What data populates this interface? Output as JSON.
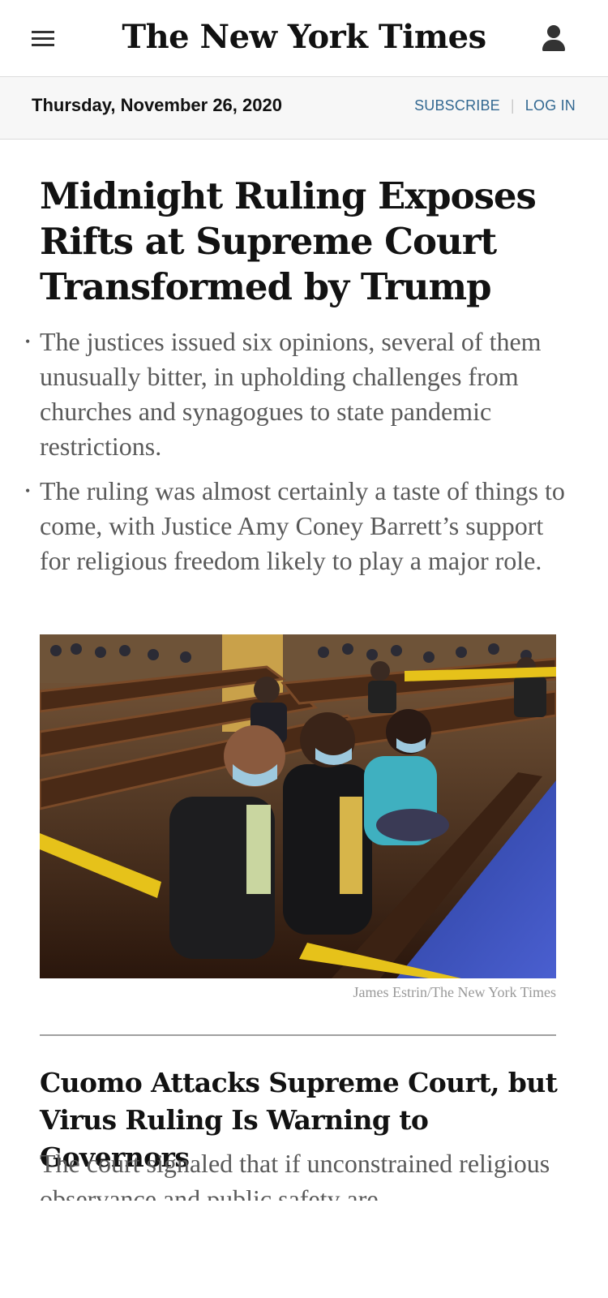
{
  "header": {
    "logo_text": "The New York Times"
  },
  "datebar": {
    "date": "Thursday, November 26, 2020",
    "subscribe_label": "SUBSCRIBE",
    "separator": "|",
    "login_label": "LOG IN"
  },
  "lead_story": {
    "headline": "Midnight Ruling Exposes Rifts at Supreme Court Transformed by Trump",
    "bullets": [
      "The justices issued six opinions, several of them unusually bitter, in upholding challenges from churches and synagogues to state pandemic restrictions.",
      "The ruling was almost certainly a taste of things to come, with Justice Amy Coney Barrett’s support for religious freedom likely to play a major role."
    ],
    "photo_credit": "James Estrin/The New York Times"
  },
  "second_story": {
    "headline": "Cuomo Attacks Supreme Court, but Virus Ruling Is Warning to Governors",
    "summary": "The court signaled that if unconstrained religious observance and public safety are"
  },
  "icons": {
    "menu": "hamburger-menu-icon",
    "account": "user-account-icon",
    "bullet": "bullet-icon"
  },
  "colors": {
    "link_blue": "#326891",
    "date_bar_bg": "#f7f7f7",
    "summary_gray": "#5a5a5a",
    "credit_gray": "#999999"
  }
}
